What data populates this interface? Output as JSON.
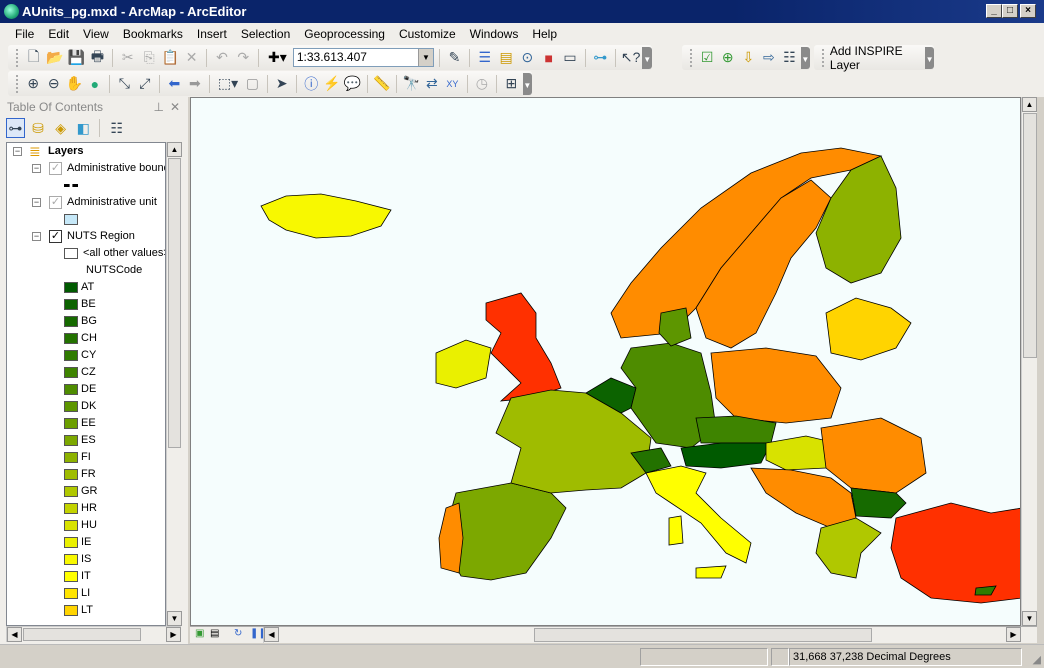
{
  "window": {
    "title": "AUnits_pg.mxd - ArcMap - ArcEditor",
    "controls": [
      "minimize",
      "maximize",
      "close"
    ]
  },
  "menu": [
    "File",
    "Edit",
    "View",
    "Bookmarks",
    "Insert",
    "Selection",
    "Geoprocessing",
    "Customize",
    "Windows",
    "Help"
  ],
  "standard_toolbar": {
    "scale_value": "1:33.613.407",
    "icons": [
      "new-icon",
      "open-icon",
      "save-icon",
      "print-icon",
      "cut-icon",
      "copy-icon",
      "paste-icon",
      "delete-icon",
      "undo-icon",
      "redo-icon",
      "add-data-icon"
    ],
    "right_icons": [
      "editor-icon",
      "table-of-contents-icon",
      "catalog-icon",
      "search-icon",
      "arctoolbox-icon",
      "python-icon",
      "model-builder-icon",
      "whats-this-icon"
    ]
  },
  "inspire_toolbar": {
    "icons": [
      "validate-icon",
      "zoom-layer-icon",
      "import-icon",
      "export-icon",
      "list-icon"
    ],
    "add_layer_label": "Add INSPIRE Layer"
  },
  "tools_toolbar": {
    "icons": [
      "zoom-in-icon",
      "zoom-out-icon",
      "pan-icon",
      "full-extent-icon",
      "fixed-zoom-in-icon",
      "fixed-zoom-out-icon",
      "back-icon",
      "forward-icon",
      "select-features-icon",
      "clear-selection-icon",
      "select-elements-icon",
      "identify-icon",
      "hyperlink-icon",
      "html-popup-icon",
      "measure-icon",
      "find-icon",
      "find-route-icon",
      "go-to-xy-icon",
      "time-slider-icon",
      "magnifier-icon"
    ]
  },
  "toc": {
    "title": "Table Of Contents",
    "layers_label": "Layers",
    "layers": [
      {
        "name": "Administrative bound",
        "checked": true,
        "dimmed": true
      },
      {
        "name": "Administrative unit",
        "checked": true,
        "dimmed": true,
        "swatch": "#c6e8f8"
      },
      {
        "name": "NUTS Region",
        "checked": true
      }
    ],
    "all_other_values": "<all other values>",
    "field": "NUTSCode",
    "legend": [
      {
        "code": "AT",
        "color": "#005a00"
      },
      {
        "code": "BE",
        "color": "#0c6300"
      },
      {
        "code": "BG",
        "color": "#166a00"
      },
      {
        "code": "CH",
        "color": "#237200"
      },
      {
        "code": "CY",
        "color": "#2f7b00"
      },
      {
        "code": "CZ",
        "color": "#3e8400"
      },
      {
        "code": "DE",
        "color": "#4e8c00"
      },
      {
        "code": "DK",
        "color": "#5d9600"
      },
      {
        "code": "EE",
        "color": "#6c9f00"
      },
      {
        "code": "ES",
        "color": "#7ca800"
      },
      {
        "code": "FI",
        "color": "#8db200"
      },
      {
        "code": "FR",
        "color": "#9fbc00"
      },
      {
        "code": "GR",
        "color": "#b0c800"
      },
      {
        "code": "HR",
        "color": "#c3d300"
      },
      {
        "code": "HU",
        "color": "#d8e200"
      },
      {
        "code": "IE",
        "color": "#eaf000"
      },
      {
        "code": "IS",
        "color": "#f8f800"
      },
      {
        "code": "IT",
        "color": "#ffff00"
      },
      {
        "code": "LI",
        "color": "#ffe400"
      },
      {
        "code": "LT",
        "color": "#ffd400"
      }
    ]
  },
  "status": {
    "coords": "31,668  37,238 Decimal Degrees"
  }
}
